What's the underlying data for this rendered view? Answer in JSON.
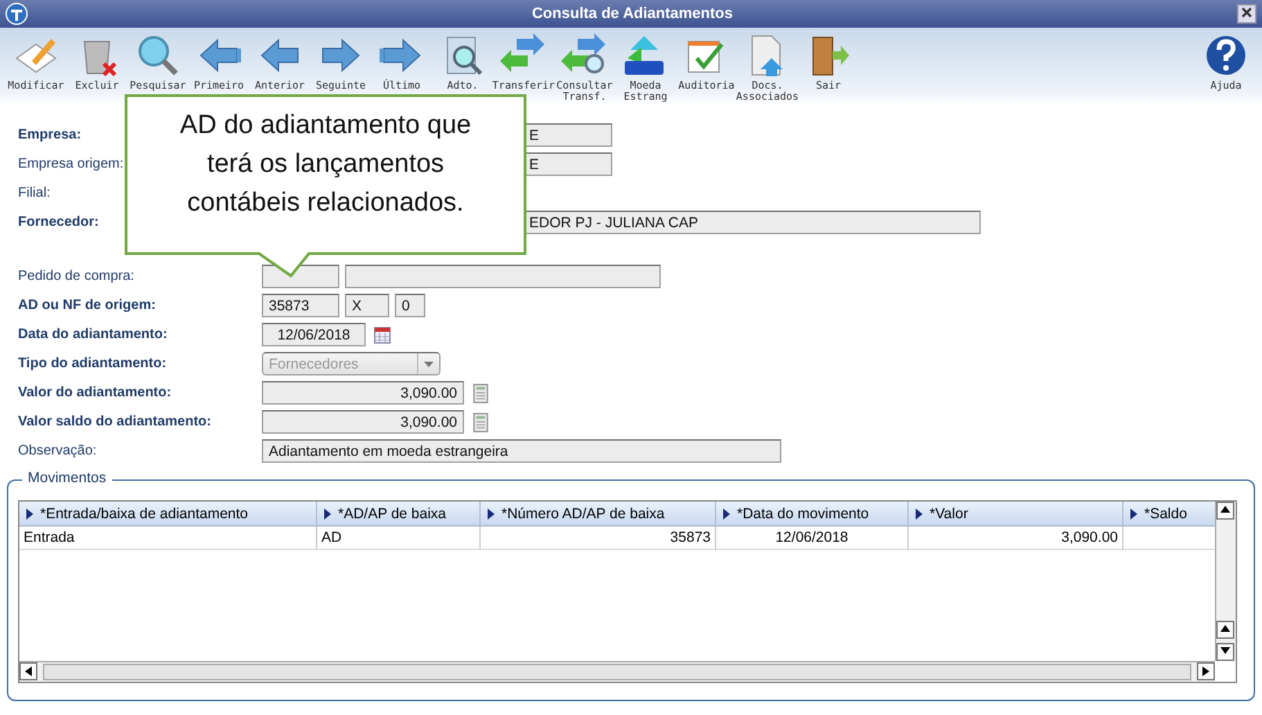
{
  "window": {
    "title": "Consulta de Adiantamentos"
  },
  "toolbar": [
    {
      "label": "Modificar"
    },
    {
      "label": "Excluir"
    },
    {
      "label": "Pesquisar"
    },
    {
      "label": "Primeiro"
    },
    {
      "label": "Anterior"
    },
    {
      "label": "Seguinte"
    },
    {
      "label": "Último"
    },
    {
      "label": "Adto."
    },
    {
      "label": "Transferir"
    },
    {
      "label": "Consultar Transf."
    },
    {
      "label": "Moeda Estrang"
    },
    {
      "label": "Auditoria"
    },
    {
      "label": "Docs. Associados"
    },
    {
      "label": "Sair"
    }
  ],
  "help": {
    "label": "Ajuda"
  },
  "callout": {
    "text": "AD do adiantamento que terá os lançamentos contábeis relacionados."
  },
  "company_fields": [
    {
      "label": "Empresa:",
      "bold": true,
      "kind": "partial",
      "values": [
        "E"
      ]
    },
    {
      "label": "Empresa origem:",
      "bold": false,
      "kind": "partial",
      "values": [
        "E"
      ]
    },
    {
      "label": "Filial:",
      "bold": false,
      "kind": "label"
    },
    {
      "label": "Fornecedor:",
      "bold": true,
      "kind": "partial-wide",
      "values": [
        "EDOR PJ - JULIANA CAP"
      ]
    }
  ],
  "advance_fields": [
    {
      "label": "Pedido de compra:",
      "bold": false,
      "kind": "pair"
    },
    {
      "label": "AD ou NF de origem:",
      "bold": true,
      "kind": "triple",
      "values": [
        "35873",
        "X",
        "0"
      ]
    },
    {
      "label": "Data do adiantamento:",
      "bold": true,
      "kind": "date",
      "values": [
        "12/06/2018"
      ]
    },
    {
      "label": "Tipo do adiantamento:",
      "bold": true,
      "kind": "select",
      "values": [
        "Fornecedores"
      ]
    },
    {
      "label": "Valor do adiantamento:",
      "bold": true,
      "kind": "money",
      "values": [
        "3,090.00"
      ]
    },
    {
      "label": "Valor saldo do adiantamento:",
      "bold": true,
      "kind": "money",
      "values": [
        "3,090.00"
      ]
    },
    {
      "label": "Observação:",
      "bold": false,
      "kind": "text",
      "values": [
        "Adiantamento em moeda estrangeira"
      ]
    }
  ],
  "movimentos": {
    "title": "Movimentos",
    "columns": [
      {
        "label": "*Entrada/baixa de adiantamento"
      },
      {
        "label": "*AD/AP de baixa"
      },
      {
        "label": "*Número AD/AP de baixa"
      },
      {
        "label": "*Data do movimento"
      },
      {
        "label": "*Valor"
      },
      {
        "label": "*Saldo"
      }
    ],
    "rows": [
      {
        "cells": [
          "Entrada",
          "AD",
          "35873",
          "12/06/2018",
          "3,090.00"
        ]
      }
    ]
  }
}
